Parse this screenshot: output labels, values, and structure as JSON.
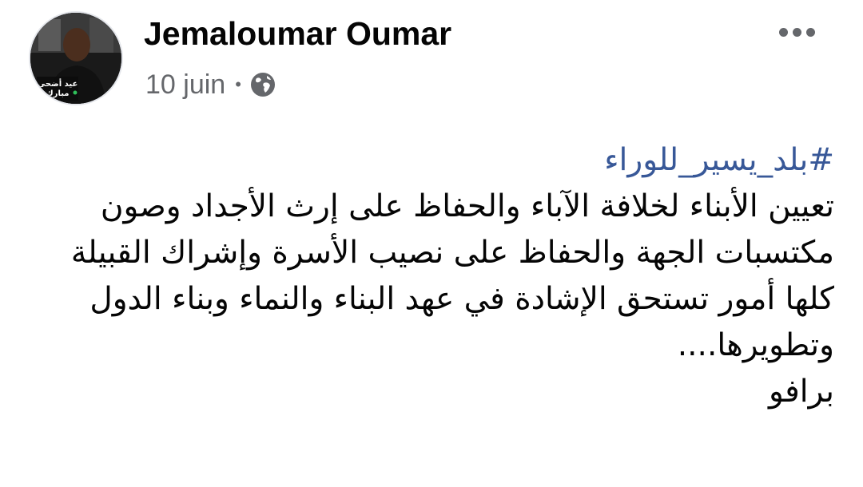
{
  "post": {
    "author": "Jemaloumar Oumar",
    "date": "10 juin",
    "separator": "•",
    "audience_icon": "globe-icon",
    "hashtag": "#بلد_يسير_للوراء",
    "paragraphs": [
      "تعيين الأبناء لخلافة الآباء والحفاظ على إرث الأجداد وصون مكتسبات الجهة والحفاظ على نصيب الأسرة وإشراك القبيلة كلها أمور تستحق الإشادة في عهد البناء والنماء وبناء الدول وتطويرها....",
      "برافو"
    ],
    "avatar_badge": [
      "عيد أضحى",
      "مبارك"
    ]
  },
  "colors": {
    "text": "#050505",
    "secondary": "#65676b",
    "link": "#385898"
  }
}
